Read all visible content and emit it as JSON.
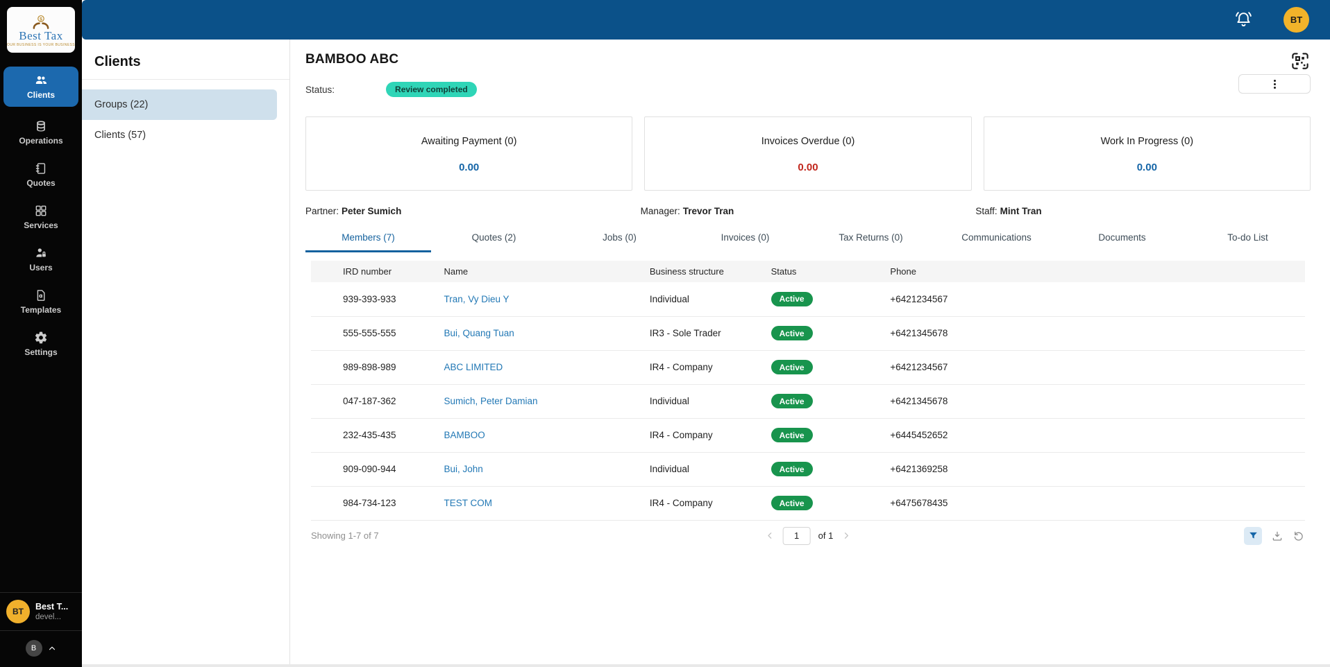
{
  "logo": {
    "title": "Best Tax",
    "tagline": "OUR BUSINESS IS YOUR BUSINESS"
  },
  "topbar": {
    "avatar_initials": "BT"
  },
  "sidebar": {
    "items": [
      {
        "label": "Clients",
        "icon": "clients-icon"
      },
      {
        "label": "Operations",
        "icon": "operations-icon"
      },
      {
        "label": "Quotes",
        "icon": "quotes-icon"
      },
      {
        "label": "Services",
        "icon": "services-icon"
      },
      {
        "label": "Users",
        "icon": "users-icon"
      },
      {
        "label": "Templates",
        "icon": "templates-icon"
      },
      {
        "label": "Settings",
        "icon": "settings-icon"
      }
    ],
    "user": {
      "avatar_initials": "BT",
      "name": "Best T...",
      "subtitle": "devel...",
      "collapse_initial": "B"
    }
  },
  "clients_panel": {
    "title": "Clients",
    "items": [
      {
        "label": "Groups (22)"
      },
      {
        "label": "Clients (57)"
      }
    ]
  },
  "main": {
    "title": "BAMBOO ABC",
    "status": {
      "label": "Status:",
      "value": "Review completed"
    },
    "cards": [
      {
        "title": "Awaiting Payment (0)",
        "value": "0.00",
        "value_color": "#1565A7"
      },
      {
        "title": "Invoices Overdue (0)",
        "value": "0.00",
        "value_color": "#C1271D"
      },
      {
        "title": "Work In Progress (0)",
        "value": "0.00",
        "value_color": "#1565A7"
      }
    ],
    "people": [
      {
        "label": "Partner:",
        "name": "Peter Sumich"
      },
      {
        "label": "Manager:",
        "name": "Trevor Tran"
      },
      {
        "label": "Staff:",
        "name": "Mint Tran"
      }
    ],
    "tabs": [
      {
        "label": "Members (7)"
      },
      {
        "label": "Quotes (2)"
      },
      {
        "label": "Jobs (0)"
      },
      {
        "label": "Invoices (0)"
      },
      {
        "label": "Tax Returns (0)"
      },
      {
        "label": "Communications"
      },
      {
        "label": "Documents"
      },
      {
        "label": "To-do List"
      }
    ],
    "table": {
      "headers": [
        "IRD number",
        "Name",
        "Business structure",
        "Status",
        "Phone"
      ],
      "rows": [
        {
          "ird": "939-393-933",
          "name": "Tran, Vy Dieu Y",
          "structure": "Individual",
          "status": "Active",
          "phone": "+6421234567"
        },
        {
          "ird": "555-555-555",
          "name": "Bui, Quang Tuan",
          "structure": "IR3 - Sole Trader",
          "status": "Active",
          "phone": "+6421345678"
        },
        {
          "ird": "989-898-989",
          "name": "ABC LIMITED",
          "structure": "IR4 - Company",
          "status": "Active",
          "phone": "+6421234567"
        },
        {
          "ird": "047-187-362",
          "name": "Sumich, Peter Damian",
          "structure": "Individual",
          "status": "Active",
          "phone": "+6421345678"
        },
        {
          "ird": "232-435-435",
          "name": "BAMBOO",
          "structure": "IR4 - Company",
          "status": "Active",
          "phone": "+6445452652"
        },
        {
          "ird": "909-090-944",
          "name": "Bui, John",
          "structure": "Individual",
          "status": "Active",
          "phone": "+6421369258"
        },
        {
          "ird": "984-734-123",
          "name": "TEST COM",
          "structure": "IR4 - Company",
          "status": "Active",
          "phone": "+6475678435"
        }
      ]
    },
    "pagination": {
      "showing": "Showing 1-7 of 7",
      "page": "1",
      "of_label": "of 1"
    }
  },
  "colors": {
    "topbar_blue": "#0B5189",
    "nav_active_blue": "#1C69AE",
    "status_badge_bg": "#2FD5B7",
    "status_badge_text": "#113F38",
    "active_pill_green": "#18944D",
    "link_blue": "#2278B5",
    "tab_active_blue": "#15629E",
    "value_blue": "#1565A7",
    "value_red": "#C1271D",
    "selected_item_bg": "#CFE0EC",
    "avatar_yellow": "#F2B32A"
  }
}
